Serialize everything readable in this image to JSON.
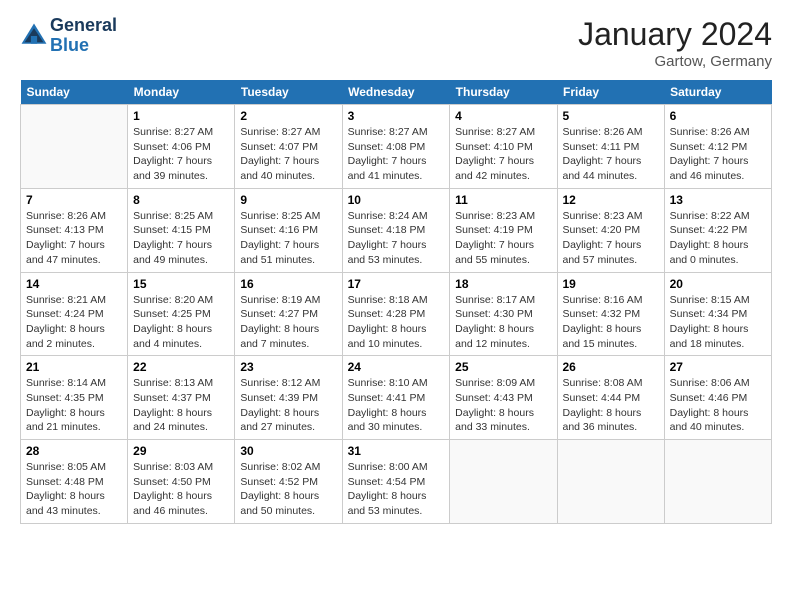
{
  "logo": {
    "line1": "General",
    "line2": "Blue"
  },
  "title": "January 2024",
  "location": "Gartow, Germany",
  "weekdays": [
    "Sunday",
    "Monday",
    "Tuesday",
    "Wednesday",
    "Thursday",
    "Friday",
    "Saturday"
  ],
  "weeks": [
    [
      {
        "day": "",
        "sunrise": "",
        "sunset": "",
        "daylight": ""
      },
      {
        "day": "1",
        "sunrise": "Sunrise: 8:27 AM",
        "sunset": "Sunset: 4:06 PM",
        "daylight": "Daylight: 7 hours and 39 minutes."
      },
      {
        "day": "2",
        "sunrise": "Sunrise: 8:27 AM",
        "sunset": "Sunset: 4:07 PM",
        "daylight": "Daylight: 7 hours and 40 minutes."
      },
      {
        "day": "3",
        "sunrise": "Sunrise: 8:27 AM",
        "sunset": "Sunset: 4:08 PM",
        "daylight": "Daylight: 7 hours and 41 minutes."
      },
      {
        "day": "4",
        "sunrise": "Sunrise: 8:27 AM",
        "sunset": "Sunset: 4:10 PM",
        "daylight": "Daylight: 7 hours and 42 minutes."
      },
      {
        "day": "5",
        "sunrise": "Sunrise: 8:26 AM",
        "sunset": "Sunset: 4:11 PM",
        "daylight": "Daylight: 7 hours and 44 minutes."
      },
      {
        "day": "6",
        "sunrise": "Sunrise: 8:26 AM",
        "sunset": "Sunset: 4:12 PM",
        "daylight": "Daylight: 7 hours and 46 minutes."
      }
    ],
    [
      {
        "day": "7",
        "sunrise": "Sunrise: 8:26 AM",
        "sunset": "Sunset: 4:13 PM",
        "daylight": "Daylight: 7 hours and 47 minutes."
      },
      {
        "day": "8",
        "sunrise": "Sunrise: 8:25 AM",
        "sunset": "Sunset: 4:15 PM",
        "daylight": "Daylight: 7 hours and 49 minutes."
      },
      {
        "day": "9",
        "sunrise": "Sunrise: 8:25 AM",
        "sunset": "Sunset: 4:16 PM",
        "daylight": "Daylight: 7 hours and 51 minutes."
      },
      {
        "day": "10",
        "sunrise": "Sunrise: 8:24 AM",
        "sunset": "Sunset: 4:18 PM",
        "daylight": "Daylight: 7 hours and 53 minutes."
      },
      {
        "day": "11",
        "sunrise": "Sunrise: 8:23 AM",
        "sunset": "Sunset: 4:19 PM",
        "daylight": "Daylight: 7 hours and 55 minutes."
      },
      {
        "day": "12",
        "sunrise": "Sunrise: 8:23 AM",
        "sunset": "Sunset: 4:20 PM",
        "daylight": "Daylight: 7 hours and 57 minutes."
      },
      {
        "day": "13",
        "sunrise": "Sunrise: 8:22 AM",
        "sunset": "Sunset: 4:22 PM",
        "daylight": "Daylight: 8 hours and 0 minutes."
      }
    ],
    [
      {
        "day": "14",
        "sunrise": "Sunrise: 8:21 AM",
        "sunset": "Sunset: 4:24 PM",
        "daylight": "Daylight: 8 hours and 2 minutes."
      },
      {
        "day": "15",
        "sunrise": "Sunrise: 8:20 AM",
        "sunset": "Sunset: 4:25 PM",
        "daylight": "Daylight: 8 hours and 4 minutes."
      },
      {
        "day": "16",
        "sunrise": "Sunrise: 8:19 AM",
        "sunset": "Sunset: 4:27 PM",
        "daylight": "Daylight: 8 hours and 7 minutes."
      },
      {
        "day": "17",
        "sunrise": "Sunrise: 8:18 AM",
        "sunset": "Sunset: 4:28 PM",
        "daylight": "Daylight: 8 hours and 10 minutes."
      },
      {
        "day": "18",
        "sunrise": "Sunrise: 8:17 AM",
        "sunset": "Sunset: 4:30 PM",
        "daylight": "Daylight: 8 hours and 12 minutes."
      },
      {
        "day": "19",
        "sunrise": "Sunrise: 8:16 AM",
        "sunset": "Sunset: 4:32 PM",
        "daylight": "Daylight: 8 hours and 15 minutes."
      },
      {
        "day": "20",
        "sunrise": "Sunrise: 8:15 AM",
        "sunset": "Sunset: 4:34 PM",
        "daylight": "Daylight: 8 hours and 18 minutes."
      }
    ],
    [
      {
        "day": "21",
        "sunrise": "Sunrise: 8:14 AM",
        "sunset": "Sunset: 4:35 PM",
        "daylight": "Daylight: 8 hours and 21 minutes."
      },
      {
        "day": "22",
        "sunrise": "Sunrise: 8:13 AM",
        "sunset": "Sunset: 4:37 PM",
        "daylight": "Daylight: 8 hours and 24 minutes."
      },
      {
        "day": "23",
        "sunrise": "Sunrise: 8:12 AM",
        "sunset": "Sunset: 4:39 PM",
        "daylight": "Daylight: 8 hours and 27 minutes."
      },
      {
        "day": "24",
        "sunrise": "Sunrise: 8:10 AM",
        "sunset": "Sunset: 4:41 PM",
        "daylight": "Daylight: 8 hours and 30 minutes."
      },
      {
        "day": "25",
        "sunrise": "Sunrise: 8:09 AM",
        "sunset": "Sunset: 4:43 PM",
        "daylight": "Daylight: 8 hours and 33 minutes."
      },
      {
        "day": "26",
        "sunrise": "Sunrise: 8:08 AM",
        "sunset": "Sunset: 4:44 PM",
        "daylight": "Daylight: 8 hours and 36 minutes."
      },
      {
        "day": "27",
        "sunrise": "Sunrise: 8:06 AM",
        "sunset": "Sunset: 4:46 PM",
        "daylight": "Daylight: 8 hours and 40 minutes."
      }
    ],
    [
      {
        "day": "28",
        "sunrise": "Sunrise: 8:05 AM",
        "sunset": "Sunset: 4:48 PM",
        "daylight": "Daylight: 8 hours and 43 minutes."
      },
      {
        "day": "29",
        "sunrise": "Sunrise: 8:03 AM",
        "sunset": "Sunset: 4:50 PM",
        "daylight": "Daylight: 8 hours and 46 minutes."
      },
      {
        "day": "30",
        "sunrise": "Sunrise: 8:02 AM",
        "sunset": "Sunset: 4:52 PM",
        "daylight": "Daylight: 8 hours and 50 minutes."
      },
      {
        "day": "31",
        "sunrise": "Sunrise: 8:00 AM",
        "sunset": "Sunset: 4:54 PM",
        "daylight": "Daylight: 8 hours and 53 minutes."
      },
      {
        "day": "",
        "sunrise": "",
        "sunset": "",
        "daylight": ""
      },
      {
        "day": "",
        "sunrise": "",
        "sunset": "",
        "daylight": ""
      },
      {
        "day": "",
        "sunrise": "",
        "sunset": "",
        "daylight": ""
      }
    ]
  ]
}
